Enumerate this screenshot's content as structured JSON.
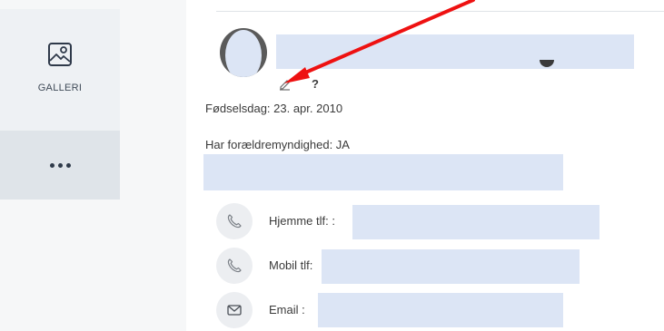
{
  "nav": {
    "gallery_label": "GALLERI",
    "more_icon": "more-dots-icon",
    "gallery_icon": "image-icon"
  },
  "profile": {
    "edit_icon": "pencil-icon",
    "help_mark": "?",
    "birthday": "Fødselsdag: 23. apr. 2010",
    "custody": "Har forældremyndighed: JA"
  },
  "contacts": [
    {
      "icon": "phone-icon",
      "label": "Hjemme tlf: :"
    },
    {
      "icon": "phone-icon",
      "label": "Mobil tlf:"
    },
    {
      "icon": "envelope-icon",
      "label": "Email :"
    }
  ],
  "colors": {
    "redaction": "#dce5f5",
    "annotation_arrow": "#ee1111",
    "nav_active": "#dfe4e9"
  }
}
